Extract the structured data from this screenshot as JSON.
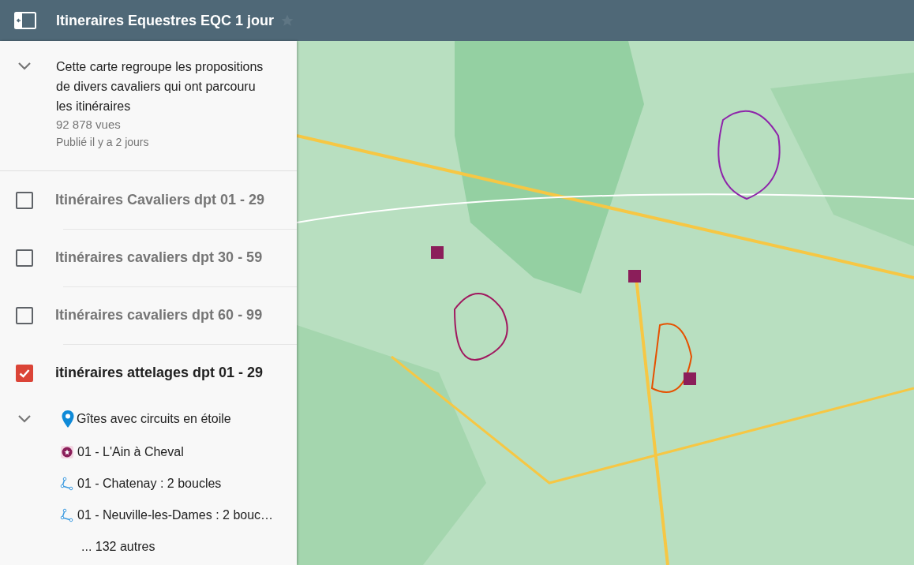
{
  "header": {
    "title": "Itineraires Equestres EQC 1 jour",
    "starred": false
  },
  "description": {
    "expanded": true,
    "text": "Cette carte regroupe les propositions de divers cavaliers qui ont parcouru les itinéraires",
    "views": "92 878 vues",
    "published": "Publié il y a 2 jours"
  },
  "layers": [
    {
      "label": "Itinéraires Cavaliers dpt 01 - 29",
      "checked": false
    },
    {
      "label": "Itinéraires cavaliers dpt 30 - 59",
      "checked": false
    },
    {
      "label": "Itinéraires cavaliers dpt 60 - 99",
      "checked": false
    },
    {
      "label": "itinéraires attelages dpt 01 - 29",
      "checked": true
    }
  ],
  "group": {
    "label": "Gîtes avec circuits en étoile",
    "expanded": true,
    "items": [
      {
        "kind": "marker",
        "label": "01 - L'Ain à Cheval"
      },
      {
        "kind": "line",
        "label": "01 - Chatenay : 2 boucles"
      },
      {
        "kind": "line",
        "label": "01 - Neuville-les-Dames : 2 bouc…"
      }
    ],
    "more": "... 132 autres"
  }
}
